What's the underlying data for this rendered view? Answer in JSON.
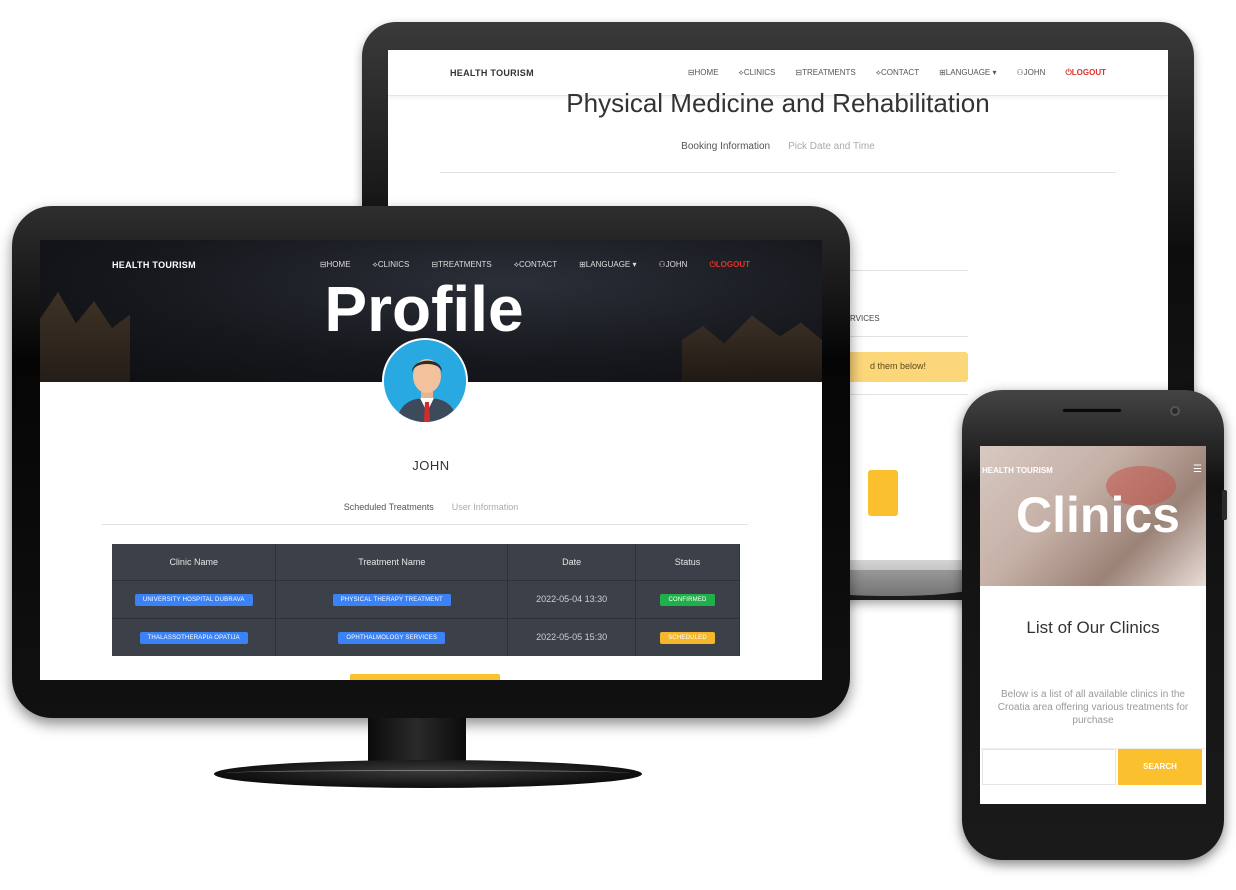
{
  "back_monitor": {
    "brand": "HEALTH TOURISM",
    "nav": [
      "⊟HOME",
      "⟡CLINICS",
      "⊟TREATMENTS",
      "⟡CONTACT",
      "⊞LANGUAGE ▾",
      "⚇JOHN"
    ],
    "logout": "⏻LOGOUT",
    "title": "Physical Medicine and Rehabilitation",
    "tabs": {
      "active": "Booking Information",
      "inactive": "Pick Date and Time"
    },
    "services_label": "RVICES",
    "alert": "d them below!"
  },
  "front_monitor": {
    "brand": "HEALTH TOURISM",
    "nav": [
      "⊟HOME",
      "⟡CLINICS",
      "⊟TREATMENTS",
      "⟡CONTACT",
      "⊞LANGUAGE ▾",
      "⚇JOHN"
    ],
    "logout": "⏻LOGOUT",
    "title": "Profile",
    "user_name": "JOHN",
    "tabs": {
      "active": "Scheduled Treatments",
      "inactive": "User Information"
    },
    "table": {
      "headers": [
        "Clinic Name",
        "Treatment Name",
        "Date",
        "Status"
      ],
      "rows": [
        {
          "clinic": "UNIVERSITY HOSPITAL DUBRAVA",
          "treatment": "PHYSICAL THERAPY TREATMENT",
          "date": "2022-05-04 13:30",
          "status": "CONFIRMED",
          "status_color": "#20b04b"
        },
        {
          "clinic": "THALASSOTHERAPIA OPATIJA",
          "treatment": "OPHTHALMOLOGY SERVICES",
          "date": "2022-05-05 15:30",
          "status": "SCHEDULED",
          "status_color": "#f5b72a"
        }
      ]
    }
  },
  "phone": {
    "brand": "HEALTH TOURISM",
    "menu_icon": "☰",
    "title": "Clinics",
    "list_title": "List of Our Clinics",
    "description": "Below is a list of all available clinics in the Croatia area offering various treatments for purchase",
    "search_placeholder": "",
    "search_button": "SEARCH"
  },
  "colors": {
    "accent": "#fbc02d",
    "logout": "#e0322b",
    "table_bg": "#3b4049",
    "avatar_bg": "#29a9e1"
  }
}
